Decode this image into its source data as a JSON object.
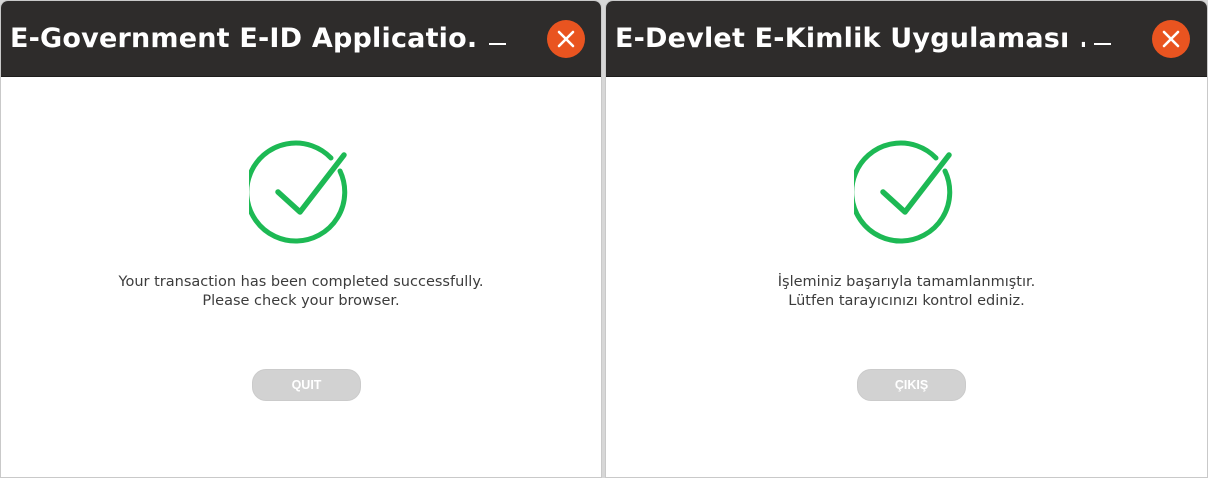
{
  "windows": [
    {
      "title": "E-Government E-ID Applicatio...",
      "message_line1": "Your transaction has been completed successfully.",
      "message_line2": "Please check your browser.",
      "button_label": "QUIT"
    },
    {
      "title": "E-Devlet E-Kimlik Uygulaması ...",
      "message_line1": "İşleminiz başarıyla tamamlanmıştır.",
      "message_line2": "Lütfen tarayıcınızı kontrol ediniz.",
      "button_label": "ÇIKIŞ"
    }
  ],
  "icons": {
    "success": "check-circle-icon",
    "close": "close-icon",
    "minimize": "minimize-icon"
  },
  "colors": {
    "titlebar": "#2e2c2b",
    "close_button": "#e95420",
    "success_green": "#1db954",
    "button_disabled": "#d2d2d2"
  }
}
